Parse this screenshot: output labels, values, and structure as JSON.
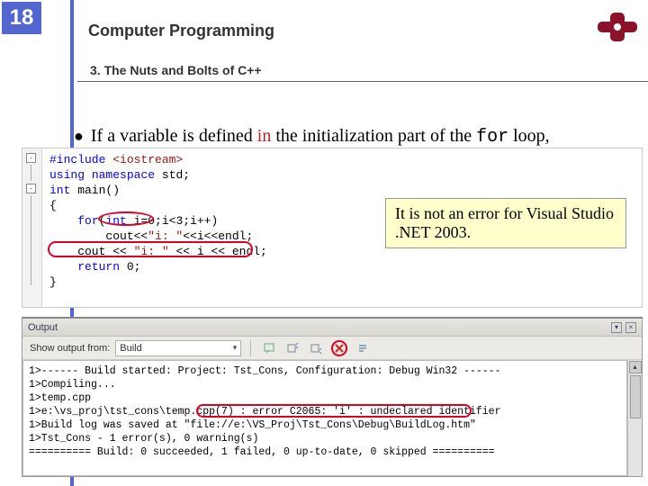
{
  "slide": {
    "number": "18"
  },
  "header": {
    "title": "Computer Programming",
    "subtitle": "3. The Nuts and Bolts of C++"
  },
  "bullet": {
    "prefix": "If a variable is defined ",
    "in_word": "in",
    "mid": " the initialization part of the ",
    "for_word": "for",
    "suffix": " loop,"
  },
  "code": {
    "l1a": "#include",
    "l1b": " <iostream>",
    "l2a": "using",
    "l2b": " ",
    "l2c": "namespace",
    "l2d": " std;",
    "l3a": "int",
    "l3b": " main()",
    "l4": "{",
    "l5a": "    ",
    "l5b": "for",
    "l5c": "(",
    "l5d": "int",
    "l5e": " i=0;i<3;i++)",
    "l6a": "        cout<<",
    "l6b": "\"i: \"",
    "l6c": "<<i<<endl;",
    "l7a": "    cout << ",
    "l7b": "\"i: \"",
    "l7c": " << i << endl;",
    "l8a": "    ",
    "l8b": "return",
    "l8c": " 0;",
    "l9": "}"
  },
  "callout": {
    "text": "It is not an error for Visual Studio .NET 2003."
  },
  "output": {
    "title": "Output",
    "show_label": "Show output from:",
    "combo_value": "Build",
    "wnd": {
      "pin": "▾",
      "close": "×"
    },
    "lines": "1>------ Build started: Project: Tst_Cons, Configuration: Debug Win32 ------\n1>Compiling...\n1>temp.cpp\n1>e:\\vs_proj\\tst_cons\\temp.cpp(7) : error C2065: 'i' : undeclared identifier\n1>Build log was saved at \"file://e:\\VS_Proj\\Tst_Cons\\Debug\\BuildLog.htm\"\n1>Tst_Cons - 1 error(s), 0 warning(s)\n========== Build: 0 succeeded, 1 failed, 0 up-to-date, 0 skipped =========="
  }
}
